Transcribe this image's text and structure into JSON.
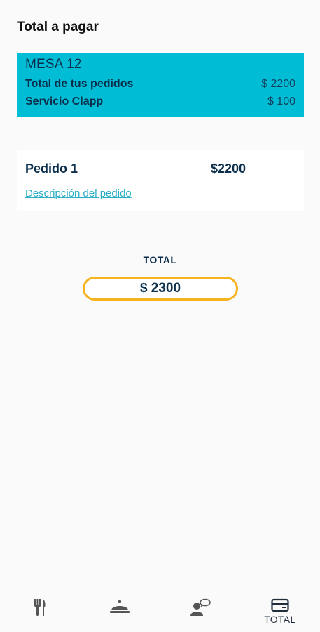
{
  "header": {
    "title": "Total a pagar"
  },
  "table": {
    "name": "MESA 12",
    "rows": [
      {
        "label": "Total de tus pedidos",
        "value": "$ 2200"
      },
      {
        "label": "Servicio Clapp",
        "value": "$ 100"
      }
    ]
  },
  "orders": [
    {
      "name": "Pedido 1",
      "amount": "$2200",
      "description": "Descripción del pedido"
    }
  ],
  "total": {
    "label": "TOTAL",
    "value": "$ 2300"
  },
  "bottom_nav": {
    "items": [
      {
        "icon": "cutlery-icon",
        "label": ""
      },
      {
        "icon": "cloche-icon",
        "label": ""
      },
      {
        "icon": "waiter-call-icon",
        "label": ""
      },
      {
        "icon": "wallet-icon",
        "label": "TOTAL"
      }
    ]
  },
  "colors": {
    "accent": "#00bcd4",
    "pill_border": "#f5b320",
    "text_dark": "#0a2e4c",
    "link": "#2aaec4"
  }
}
